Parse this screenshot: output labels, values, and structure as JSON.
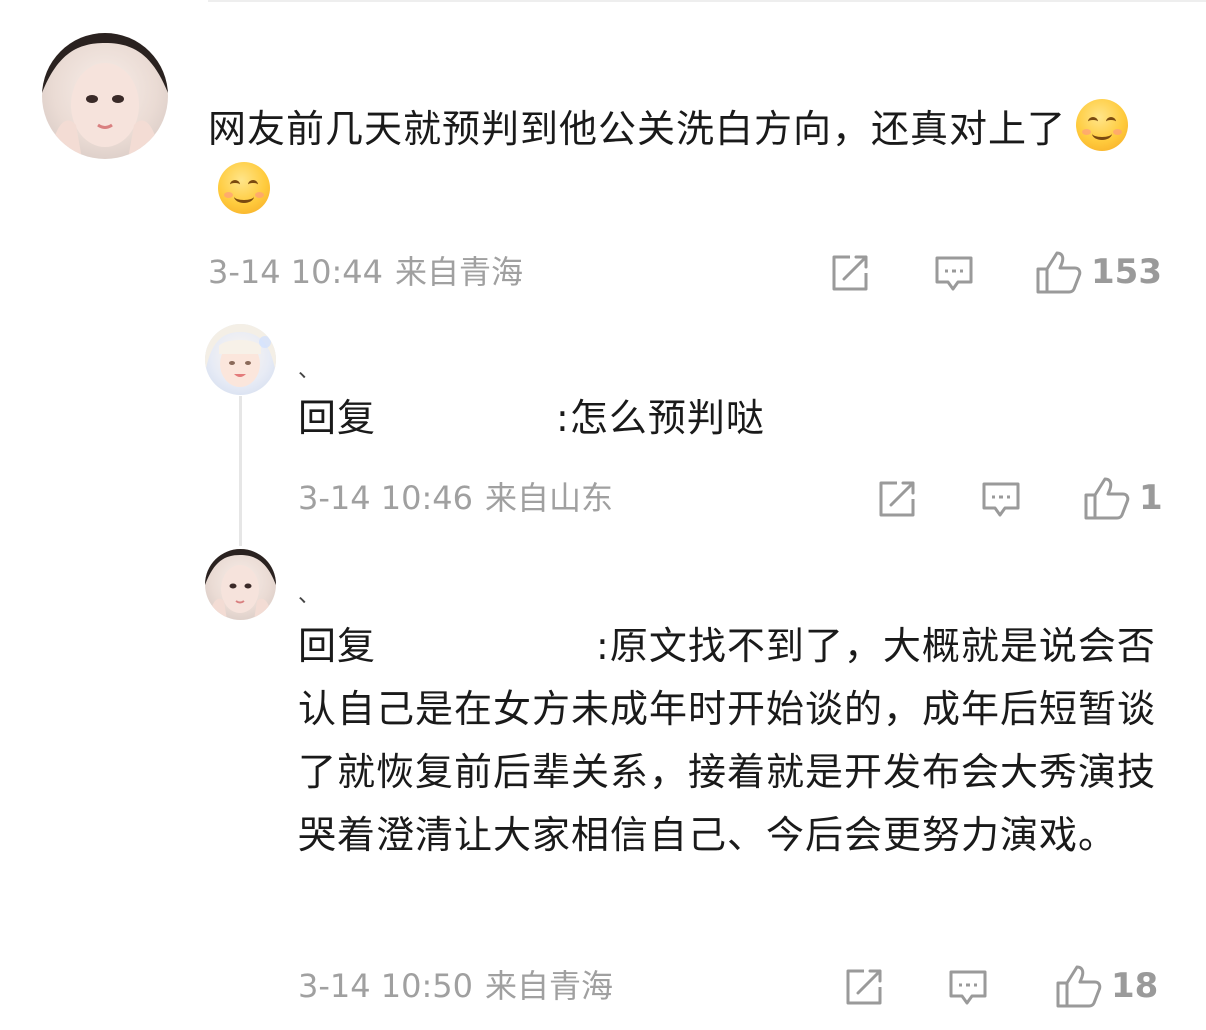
{
  "main_comment": {
    "text": "网友前几天就预判到他公关洗白方向，还真对上了",
    "emoji": [
      "smiling-face-emoji",
      "smiling-face-emoji"
    ],
    "date": "3-14 10:44",
    "location": "来自青海",
    "like_count": "153"
  },
  "replies": [
    {
      "username": "、",
      "prefix": "回复",
      "suffix": ":怎么预判哒",
      "date": "3-14 10:46",
      "location": "来自山东",
      "like_count": "1"
    },
    {
      "username": "、",
      "prefix": "回复",
      "suffix": ":原文找不到了，大概就是说会否认自己是在女方未成年时开始谈的，成年后短暂谈了就恢复前后辈关系，接着就是开发布会大秀演技哭着澄清让大家相信自己、今后会更努力演戏。",
      "date": "3-14 10:50",
      "location": "来自青海",
      "like_count": "18"
    }
  ],
  "icons": {
    "share": "share-icon",
    "comment": "comment-icon",
    "like": "thumbs-up-icon"
  },
  "colors": {
    "text": "#1a1a1a",
    "meta": "#a0a0a0",
    "icon": "#9a9a9a"
  }
}
